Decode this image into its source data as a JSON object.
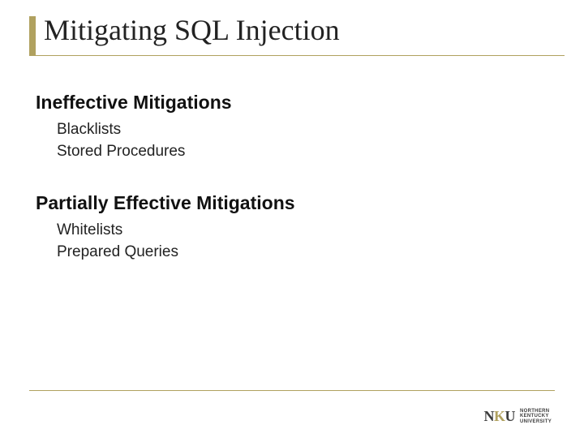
{
  "title": "Mitigating SQL Injection",
  "sections": [
    {
      "heading": "Ineffective Mitigations",
      "items": [
        "Blacklists",
        "Stored Procedures"
      ]
    },
    {
      "heading": "Partially Effective Mitigations",
      "items": [
        "Whitelists",
        "Prepared Queries"
      ]
    }
  ],
  "logo": {
    "mark_left": "N",
    "mark_mid": "K",
    "mark_right": "U",
    "line1": "NORTHERN",
    "line2": "KENTUCKY",
    "line3": "UNIVERSITY"
  }
}
